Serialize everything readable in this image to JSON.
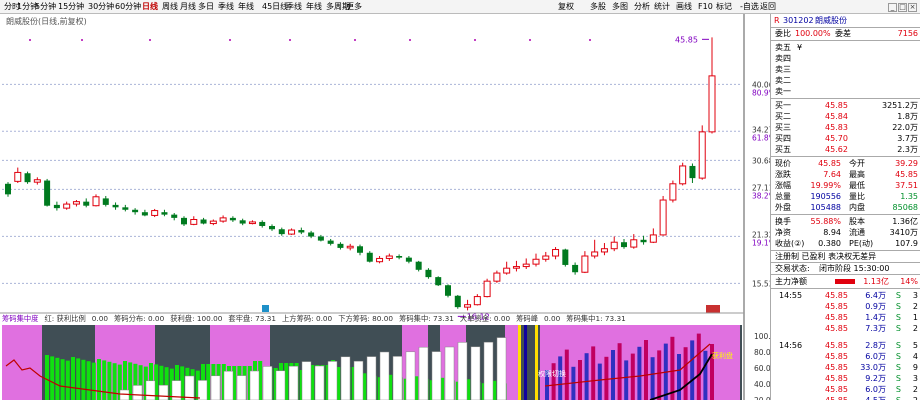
{
  "toolbar": {
    "periods": [
      "分时",
      "1分钟",
      "5分钟",
      "15分钟",
      "30分钟",
      "60分钟",
      "日线",
      "周线",
      "月线",
      "多日",
      "季线",
      "年线",
      "45日线",
      "季线",
      "年线",
      "多周期",
      "更多"
    ],
    "right_buttons": [
      "复权",
      "叠加",
      "统计",
      "画线",
      "F10",
      "标记",
      "-自选",
      "返回"
    ],
    "right_buttons_mid": [
      "多股",
      "多图",
      "分析"
    ]
  },
  "chart": {
    "title": "朗威股份(日线,前复权)",
    "price_high_label": "45.85",
    "price_low_label": "16.12",
    "price_axis": [
      "40.06",
      "80.9%",
      "34.27",
      "61.8%",
      "30.68",
      "27.11",
      "38.2%",
      "21.32",
      "19.1%",
      "15.53"
    ],
    "indicator_axis": [
      "100.0",
      "80.0",
      "60.0",
      "40.0",
      "20.0"
    ],
    "indicator_legend": [
      "筹码集中度",
      "红: 获利比例",
      "0.00",
      "筹码分布: 0.00",
      "获利盘: 100.00",
      "套牢盘: 73.31",
      "上方筹码: 0.00",
      "下方筹码: 80.00",
      "筹码集中: 73.31",
      "大单资金: 0.00",
      "筹码峰",
      "0.00",
      "筹码集中1: 73.31"
    ],
    "annotations": {
      "lowline": "权限切换",
      "rightlabel": "获利盘"
    }
  },
  "chart_data": {
    "type": "candlestick",
    "title": "朗威股份(日线,前复权)",
    "candles": [
      {
        "o": 26.5,
        "c": 27.8,
        "h": 28.0,
        "l": 26.2,
        "up": false
      },
      {
        "o": 28.1,
        "c": 29.2,
        "h": 29.8,
        "l": 27.9,
        "up": true
      },
      {
        "o": 29.1,
        "c": 28.0,
        "h": 29.3,
        "l": 27.8,
        "up": false
      },
      {
        "o": 28.0,
        "c": 28.3,
        "h": 28.6,
        "l": 27.7,
        "up": true
      },
      {
        "o": 28.2,
        "c": 25.1,
        "h": 28.4,
        "l": 25.0,
        "up": false
      },
      {
        "o": 25.2,
        "c": 24.8,
        "h": 25.6,
        "l": 24.5,
        "up": false
      },
      {
        "o": 24.8,
        "c": 25.3,
        "h": 25.6,
        "l": 24.6,
        "up": true
      },
      {
        "o": 25.3,
        "c": 25.6,
        "h": 25.8,
        "l": 25.0,
        "up": true
      },
      {
        "o": 25.6,
        "c": 25.1,
        "h": 26.0,
        "l": 24.9,
        "up": false
      },
      {
        "o": 25.1,
        "c": 26.2,
        "h": 26.5,
        "l": 25.0,
        "up": true
      },
      {
        "o": 26.0,
        "c": 25.2,
        "h": 26.3,
        "l": 25.0,
        "up": false
      },
      {
        "o": 25.2,
        "c": 24.9,
        "h": 25.5,
        "l": 24.6,
        "up": false
      },
      {
        "o": 24.9,
        "c": 24.6,
        "h": 25.2,
        "l": 24.4,
        "up": false
      },
      {
        "o": 24.6,
        "c": 24.3,
        "h": 24.8,
        "l": 24.0,
        "up": false
      },
      {
        "o": 24.3,
        "c": 23.9,
        "h": 24.6,
        "l": 23.8,
        "up": false
      },
      {
        "o": 23.9,
        "c": 24.5,
        "h": 24.7,
        "l": 23.7,
        "up": true
      },
      {
        "o": 24.3,
        "c": 24.0,
        "h": 24.6,
        "l": 23.8,
        "up": false
      },
      {
        "o": 24.0,
        "c": 23.6,
        "h": 24.2,
        "l": 23.3,
        "up": false
      },
      {
        "o": 23.6,
        "c": 22.8,
        "h": 23.8,
        "l": 22.6,
        "up": false
      },
      {
        "o": 22.8,
        "c": 23.4,
        "h": 23.8,
        "l": 22.7,
        "up": true
      },
      {
        "o": 23.4,
        "c": 22.9,
        "h": 23.6,
        "l": 22.8,
        "up": false
      },
      {
        "o": 22.9,
        "c": 23.2,
        "h": 23.4,
        "l": 22.7,
        "up": true
      },
      {
        "o": 23.2,
        "c": 23.6,
        "h": 23.9,
        "l": 23.0,
        "up": true
      },
      {
        "o": 23.6,
        "c": 23.3,
        "h": 23.8,
        "l": 23.1,
        "up": false
      },
      {
        "o": 23.3,
        "c": 22.9,
        "h": 23.5,
        "l": 22.7,
        "up": false
      },
      {
        "o": 22.9,
        "c": 23.1,
        "h": 23.3,
        "l": 22.8,
        "up": true
      },
      {
        "o": 23.1,
        "c": 22.6,
        "h": 23.3,
        "l": 22.4,
        "up": false
      },
      {
        "o": 22.6,
        "c": 22.2,
        "h": 22.8,
        "l": 22.0,
        "up": false
      },
      {
        "o": 22.2,
        "c": 21.6,
        "h": 22.4,
        "l": 21.4,
        "up": false
      },
      {
        "o": 21.6,
        "c": 22.1,
        "h": 22.3,
        "l": 21.5,
        "up": true
      },
      {
        "o": 22.1,
        "c": 21.8,
        "h": 22.4,
        "l": 21.6,
        "up": false
      },
      {
        "o": 21.8,
        "c": 21.3,
        "h": 22.0,
        "l": 21.1,
        "up": false
      },
      {
        "o": 21.3,
        "c": 20.8,
        "h": 21.5,
        "l": 20.7,
        "up": false
      },
      {
        "o": 20.8,
        "c": 20.4,
        "h": 21.0,
        "l": 20.2,
        "up": false
      },
      {
        "o": 20.4,
        "c": 19.9,
        "h": 20.6,
        "l": 19.7,
        "up": false
      },
      {
        "o": 19.9,
        "c": 20.1,
        "h": 20.4,
        "l": 19.6,
        "up": true
      },
      {
        "o": 20.1,
        "c": 19.3,
        "h": 20.3,
        "l": 19.0,
        "up": false
      },
      {
        "o": 19.3,
        "c": 18.2,
        "h": 19.5,
        "l": 18.1,
        "up": false
      },
      {
        "o": 18.2,
        "c": 18.6,
        "h": 18.9,
        "l": 18.0,
        "up": true
      },
      {
        "o": 18.6,
        "c": 18.9,
        "h": 19.2,
        "l": 18.3,
        "up": true
      },
      {
        "o": 18.9,
        "c": 18.7,
        "h": 19.1,
        "l": 18.5,
        "up": false
      },
      {
        "o": 18.7,
        "c": 18.2,
        "h": 18.9,
        "l": 18.0,
        "up": false
      },
      {
        "o": 18.2,
        "c": 17.2,
        "h": 18.3,
        "l": 17.0,
        "up": false
      },
      {
        "o": 17.2,
        "c": 16.3,
        "h": 17.4,
        "l": 16.1,
        "up": false
      },
      {
        "o": 16.3,
        "c": 15.3,
        "h": 16.4,
        "l": 15.2,
        "up": false
      },
      {
        "o": 15.3,
        "c": 14.0,
        "h": 15.4,
        "l": 13.8,
        "up": false
      },
      {
        "o": 14.0,
        "c": 12.6,
        "h": 14.1,
        "l": 12.4,
        "up": false
      },
      {
        "o": 12.6,
        "c": 12.9,
        "h": 13.5,
        "l": 12.2,
        "up": true
      },
      {
        "o": 12.9,
        "c": 13.9,
        "h": 14.2,
        "l": 12.8,
        "up": true
      },
      {
        "o": 13.9,
        "c": 15.8,
        "h": 16.1,
        "l": 13.8,
        "up": true
      },
      {
        "o": 15.8,
        "c": 16.8,
        "h": 17.1,
        "l": 15.6,
        "up": true
      },
      {
        "o": 16.8,
        "c": 17.4,
        "h": 18.2,
        "l": 16.6,
        "up": true
      },
      {
        "o": 17.4,
        "c": 17.6,
        "h": 18.3,
        "l": 17.0,
        "up": true
      },
      {
        "o": 17.6,
        "c": 17.9,
        "h": 18.6,
        "l": 17.3,
        "up": true
      },
      {
        "o": 17.9,
        "c": 18.5,
        "h": 19.2,
        "l": 17.6,
        "up": true
      },
      {
        "o": 18.5,
        "c": 18.9,
        "h": 19.4,
        "l": 18.2,
        "up": true
      },
      {
        "o": 18.9,
        "c": 19.7,
        "h": 20.0,
        "l": 18.5,
        "up": true
      },
      {
        "o": 19.7,
        "c": 17.8,
        "h": 19.8,
        "l": 17.6,
        "up": false
      },
      {
        "o": 17.8,
        "c": 16.9,
        "h": 18.1,
        "l": 16.6,
        "up": false
      },
      {
        "o": 16.9,
        "c": 18.9,
        "h": 19.5,
        "l": 16.8,
        "up": true
      },
      {
        "o": 18.9,
        "c": 19.4,
        "h": 20.9,
        "l": 18.6,
        "up": true
      },
      {
        "o": 19.4,
        "c": 19.8,
        "h": 20.5,
        "l": 19.0,
        "up": true
      },
      {
        "o": 19.8,
        "c": 20.6,
        "h": 21.3,
        "l": 19.5,
        "up": true
      },
      {
        "o": 20.6,
        "c": 20.0,
        "h": 21.0,
        "l": 19.8,
        "up": false
      },
      {
        "o": 20.0,
        "c": 20.9,
        "h": 21.6,
        "l": 19.8,
        "up": true
      },
      {
        "o": 20.9,
        "c": 20.6,
        "h": 21.4,
        "l": 20.3,
        "up": false
      },
      {
        "o": 20.6,
        "c": 21.5,
        "h": 22.3,
        "l": 20.5,
        "up": true
      },
      {
        "o": 21.5,
        "c": 25.8,
        "h": 26.3,
        "l": 21.4,
        "up": true
      },
      {
        "o": 25.8,
        "c": 27.8,
        "h": 28.2,
        "l": 25.5,
        "up": true
      },
      {
        "o": 27.8,
        "c": 30.0,
        "h": 30.4,
        "l": 27.6,
        "up": true
      },
      {
        "o": 30.0,
        "c": 28.5,
        "h": 30.3,
        "l": 27.9,
        "up": false
      },
      {
        "o": 28.5,
        "c": 34.2,
        "h": 35.0,
        "l": 28.3,
        "up": true
      },
      {
        "o": 34.2,
        "c": 41.1,
        "h": 45.85,
        "l": 34.0,
        "up": true
      }
    ]
  },
  "quote": {
    "code": "301202",
    "name": "朗威股份",
    "weibi_label": "委比",
    "weibi": "100.00%",
    "weicha_label": "委差",
    "weicha": "7156",
    "sell": [
      {
        "label": "卖五",
        "price": "",
        "vol": ""
      },
      {
        "label": "卖四",
        "price": "",
        "vol": ""
      },
      {
        "label": "卖三",
        "price": "",
        "vol": ""
      },
      {
        "label": "卖二",
        "price": "",
        "vol": ""
      },
      {
        "label": "卖一",
        "price": "",
        "vol": ""
      }
    ],
    "sell_suffix": "¥",
    "buy": [
      {
        "label": "买一",
        "price": "45.85",
        "vol": "3251.2万"
      },
      {
        "label": "买二",
        "price": "45.84",
        "vol": "1.8万"
      },
      {
        "label": "买三",
        "price": "45.83",
        "vol": "22.0万"
      },
      {
        "label": "买四",
        "price": "45.70",
        "vol": "3.7万"
      },
      {
        "label": "买五",
        "price": "45.62",
        "vol": "2.3万"
      }
    ],
    "stats": [
      {
        "l1": "现价",
        "v1": "45.85",
        "l2": "今开",
        "v2": "39.29"
      },
      {
        "l1": "涨跌",
        "v1": "7.64",
        "l2": "最高",
        "v2": "45.85"
      },
      {
        "l1": "涨幅",
        "v1": "19.99%",
        "l2": "最低",
        "v2": "37.51"
      },
      {
        "l1": "总量",
        "v1": "190556",
        "l2": "量比",
        "v2": "1.35"
      },
      {
        "l1": "外盘",
        "v1": "105488",
        "l2": "内盘",
        "v2": "85068"
      }
    ],
    "stats2": [
      {
        "l1": "换手",
        "v1": "55.88%",
        "l2": "股本",
        "v2": "1.36亿"
      },
      {
        "l1": "净资",
        "v1": "8.94",
        "l2": "流通",
        "v2": "3410万"
      },
      {
        "l1": "收益(②)",
        "v1": "0.380",
        "l2": "PE(动)",
        "v2": "107.9"
      }
    ],
    "info1": "注册制 已盈利 表决权无差异",
    "trade_state_label": "交易状态:",
    "trade_state": "闭市阶段 15:30:00",
    "main_net_label": "主力净额",
    "main_net": "1.13亿",
    "main_net_pct": "14%",
    "ticks": [
      {
        "t": "14:55",
        "p": "45.85",
        "v": "6.4万",
        "s": "S",
        "n": "3"
      },
      {
        "t": "",
        "p": "45.85",
        "v": "0.9万",
        "s": "S",
        "n": "2"
      },
      {
        "t": "",
        "p": "45.85",
        "v": "1.4万",
        "s": "S",
        "n": "1"
      },
      {
        "t": "",
        "p": "45.85",
        "v": "7.3万",
        "s": "S",
        "n": "2"
      },
      {
        "t": "14:56",
        "p": "45.85",
        "v": "2.8万",
        "s": "S",
        "n": "5"
      },
      {
        "t": "",
        "p": "45.85",
        "v": "6.0万",
        "s": "S",
        "n": "4"
      },
      {
        "t": "",
        "p": "45.85",
        "v": "33.0万",
        "s": "S",
        "n": "9"
      },
      {
        "t": "",
        "p": "45.85",
        "v": "9.2万",
        "s": "S",
        "n": "3"
      },
      {
        "t": "",
        "p": "45.85",
        "v": "6.0万",
        "s": "S",
        "n": "2"
      },
      {
        "t": "",
        "p": "45.85",
        "v": "4.5万",
        "s": "S",
        "n": "2"
      }
    ]
  },
  "colors": {
    "up": "#e0000e",
    "down": "#007a1f",
    "magenta": "#e070e0",
    "dark": "#404e55",
    "yellow": "#ffe000",
    "purple": "#8000c0"
  }
}
